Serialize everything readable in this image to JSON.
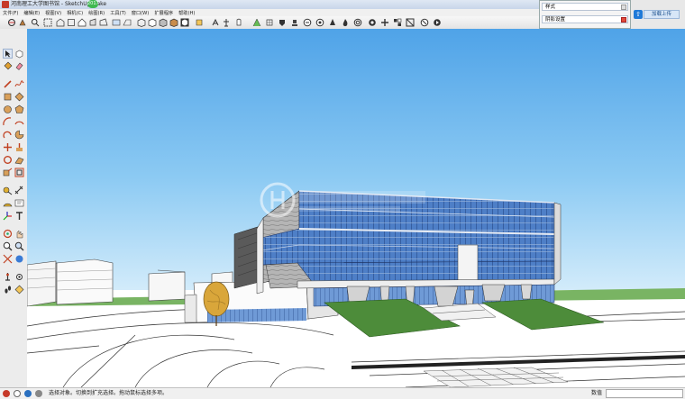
{
  "window": {
    "title": "河南理工大学图书馆 - SketchUp Make",
    "version_badge": "2017"
  },
  "menu": [
    "文件(F)",
    "编辑(E)",
    "视图(V)",
    "相机(C)",
    "绘图(R)",
    "工具(T)",
    "窗口(W)",
    "扩展程序",
    "帮助(H)"
  ],
  "tray": {
    "styles_label": "样式",
    "shadow_label": "阴影设置"
  },
  "upload_button": "加载上传",
  "status": {
    "hint": "选择对象。切换到扩充选择。拖动鼠标选择多项。",
    "measurements_label": "数值",
    "measurements_value": ""
  },
  "colors": {
    "sky_top": "#4fa3e8",
    "sky_bottom": "#d8eefb",
    "grass": "#4d8c3a",
    "glass": "#4e7fc7"
  }
}
